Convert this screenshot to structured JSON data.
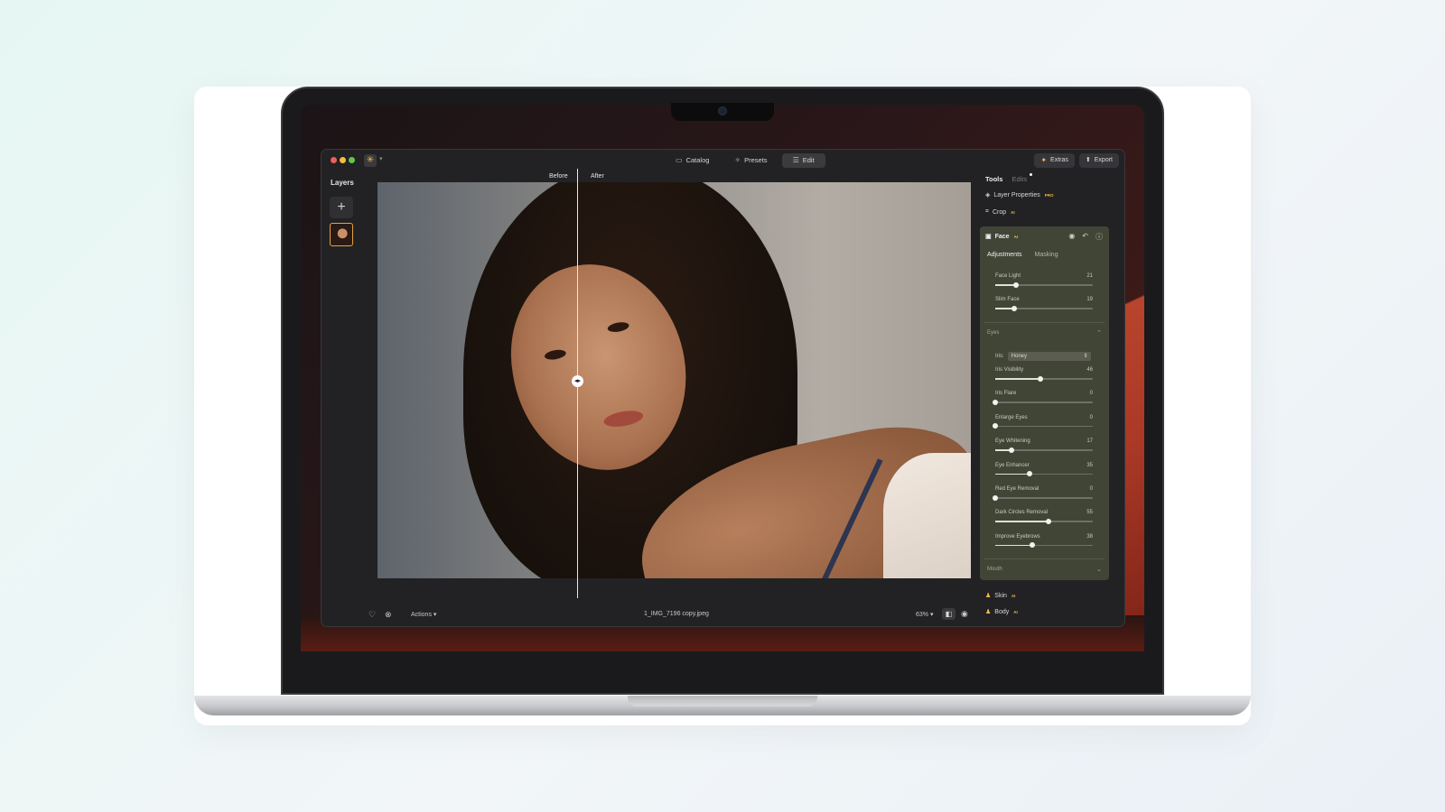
{
  "toolbar": {
    "tabs": [
      {
        "label": "Catalog",
        "icon": "catalog-icon"
      },
      {
        "label": "Presets",
        "icon": "presets-icon"
      },
      {
        "label": "Edit",
        "icon": "edit-icon",
        "active": true
      }
    ],
    "extras_label": "Extras",
    "export_label": "Export"
  },
  "layers": {
    "title": "Layers"
  },
  "canvas": {
    "before_label": "Before",
    "after_label": "After"
  },
  "bottombar": {
    "actions_label": "Actions",
    "filename": "1_IMG_7196 copy.jpeg",
    "zoom": "63%"
  },
  "panel": {
    "tabs": {
      "tools": "Tools",
      "edits": "Edits"
    },
    "layer_properties": "Layer Properties",
    "crop": "Crop",
    "pro_badge": "PRO",
    "ai_badge": "AI",
    "face": {
      "title": "Face",
      "subtabs": {
        "adjustments": "Adjustments",
        "masking": "Masking"
      },
      "sliders": [
        {
          "label": "Face Light",
          "value": 21,
          "fraction": 0.21
        },
        {
          "label": "Slim Face",
          "value": 19,
          "fraction": 0.19
        }
      ],
      "eyes": {
        "header": "Eyes",
        "iris_label": "Iris:",
        "iris_value": "Honey",
        "sliders": [
          {
            "label": "Iris Visibility",
            "value": 46,
            "fraction": 0.46
          },
          {
            "label": "Iris Flare",
            "value": 0,
            "fraction": 0.0
          },
          {
            "label": "Enlarge Eyes",
            "value": 0,
            "fraction": 0.0
          },
          {
            "label": "Eye Whitening",
            "value": 17,
            "fraction": 0.17
          },
          {
            "label": "Eye Enhancer",
            "value": 35,
            "fraction": 0.35
          },
          {
            "label": "Red Eye Removal",
            "value": 0,
            "fraction": 0.0
          },
          {
            "label": "Dark Circles Removal",
            "value": 55,
            "fraction": 0.55
          },
          {
            "label": "Improve Eyebrows",
            "value": 38,
            "fraction": 0.38
          }
        ]
      },
      "mouth_header": "Mouth"
    },
    "skin": "Skin",
    "body": "Body"
  },
  "colors": {
    "accent": "#f2b84a",
    "panel_face_bg": "#414536",
    "app_bg": "#222224"
  }
}
